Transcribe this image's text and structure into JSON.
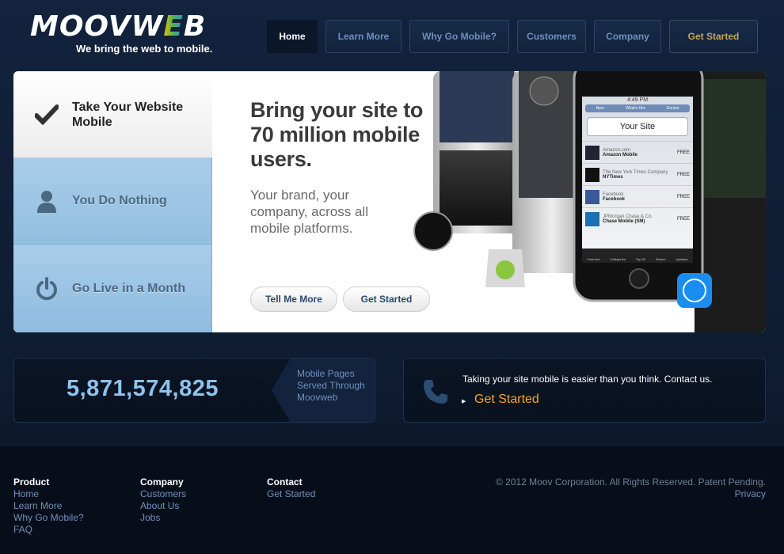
{
  "brand": {
    "logo_main": "MOOVW",
    "logo_accent": "E",
    "logo_end": "B",
    "tagline": "We bring the web to mobile."
  },
  "nav": {
    "items": [
      {
        "label": "Home"
      },
      {
        "label": "Learn More"
      },
      {
        "label": "Why Go Mobile?"
      },
      {
        "label": "Customers"
      },
      {
        "label": "Company"
      },
      {
        "label": "Get Started"
      }
    ]
  },
  "hero": {
    "features": [
      {
        "label": "Take Your Website Mobile",
        "icon": "checkmark-icon"
      },
      {
        "label": "You Do Nothing",
        "icon": "person-icon"
      },
      {
        "label": "Go Live in a Month",
        "icon": "power-icon"
      }
    ],
    "headline": "Bring your site to 70 million mobile users.",
    "subline": "Your brand, your company, across all mobile platforms.",
    "buttons": {
      "tell_more": "Tell Me More",
      "get_started": "Get Started"
    },
    "phone_screen": {
      "time": "4:49 PM",
      "tabs": [
        "New",
        "What's Hot",
        "Genius"
      ],
      "banner": "Your Site",
      "apps": [
        {
          "sub": "Amazon.com",
          "name": "Amazon Mobile",
          "price": "FREE"
        },
        {
          "sub": "The New York Times Company",
          "name": "NYTimes",
          "price": "FREE"
        },
        {
          "sub": "Facebook",
          "name": "Facebook",
          "price": "FREE"
        },
        {
          "sub": "JPMorgan Chase & Co.",
          "name": "Chase Mobile (SM)",
          "price": "FREE"
        }
      ],
      "bar": [
        "Featured",
        "Categories",
        "Top 25",
        "Search",
        "Updates"
      ]
    }
  },
  "stats": {
    "counter": "5,871,574,825",
    "counter_label": "Mobile Pages Served Through Moovweb",
    "contact_text": "Taking your site mobile is easier than you think. Contact us.",
    "contact_cta": "Get Started"
  },
  "footer": {
    "product": {
      "title": "Product",
      "links": [
        "Home",
        "Learn More",
        "Why Go Mobile?",
        "FAQ"
      ]
    },
    "company": {
      "title": "Company",
      "links": [
        "Customers",
        "About Us",
        "Jobs"
      ]
    },
    "contact": {
      "title": "Contact",
      "links": [
        "Get Started"
      ]
    },
    "copyright": "© 2012 Moov Corporation. All Rights Reserved. Patent Pending.",
    "privacy": "Privacy"
  },
  "colors": {
    "accent_orange": "#f6a623",
    "counter_blue": "#8ec3ec",
    "nav_text": "#6f8fbd"
  }
}
